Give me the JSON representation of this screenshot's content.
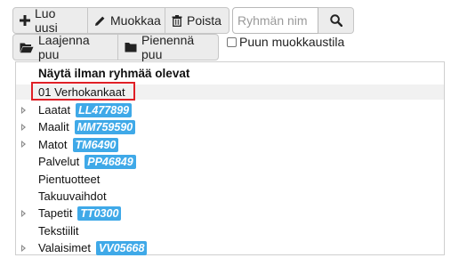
{
  "toolbar": {
    "add_label": "Luo uusi",
    "edit_label": "Muokkaa",
    "delete_label": "Poista",
    "search_placeholder": "Ryhmän nim",
    "expand_label": "Laajenna puu",
    "collapse_label": "Pienennä puu",
    "edit_mode_label": "Puun muokkaustila",
    "edit_mode_checked": false
  },
  "icons": {
    "add": "plus-icon",
    "edit": "pencil-icon",
    "delete": "trash-icon",
    "search": "search-icon",
    "expand": "folder-open-icon",
    "collapse": "folder-icon",
    "expander": "caret-right-icon"
  },
  "colors": {
    "badge": "#3fa9e8",
    "highlight": "#e01f26",
    "button_bg": "#ececec"
  },
  "tree": {
    "header": "Näytä ilman ryhmää olevat",
    "selected": "01 Verhokankaat",
    "items": [
      {
        "label": "Laatat",
        "code": "LL477899",
        "expandable": true
      },
      {
        "label": "Maalit",
        "code": "MM759590",
        "expandable": true
      },
      {
        "label": "Matot",
        "code": "TM6490",
        "expandable": true
      },
      {
        "label": "Palvelut",
        "code": "PP46849",
        "expandable": false
      },
      {
        "label": "Pientuotteet",
        "code": "",
        "expandable": false
      },
      {
        "label": "Takuuvaihdot",
        "code": "",
        "expandable": false
      },
      {
        "label": "Tapetit",
        "code": "TT0300",
        "expandable": true
      },
      {
        "label": "Tekstiilit",
        "code": "",
        "expandable": false
      },
      {
        "label": "Valaisimet",
        "code": "VV05668",
        "expandable": true
      }
    ]
  }
}
